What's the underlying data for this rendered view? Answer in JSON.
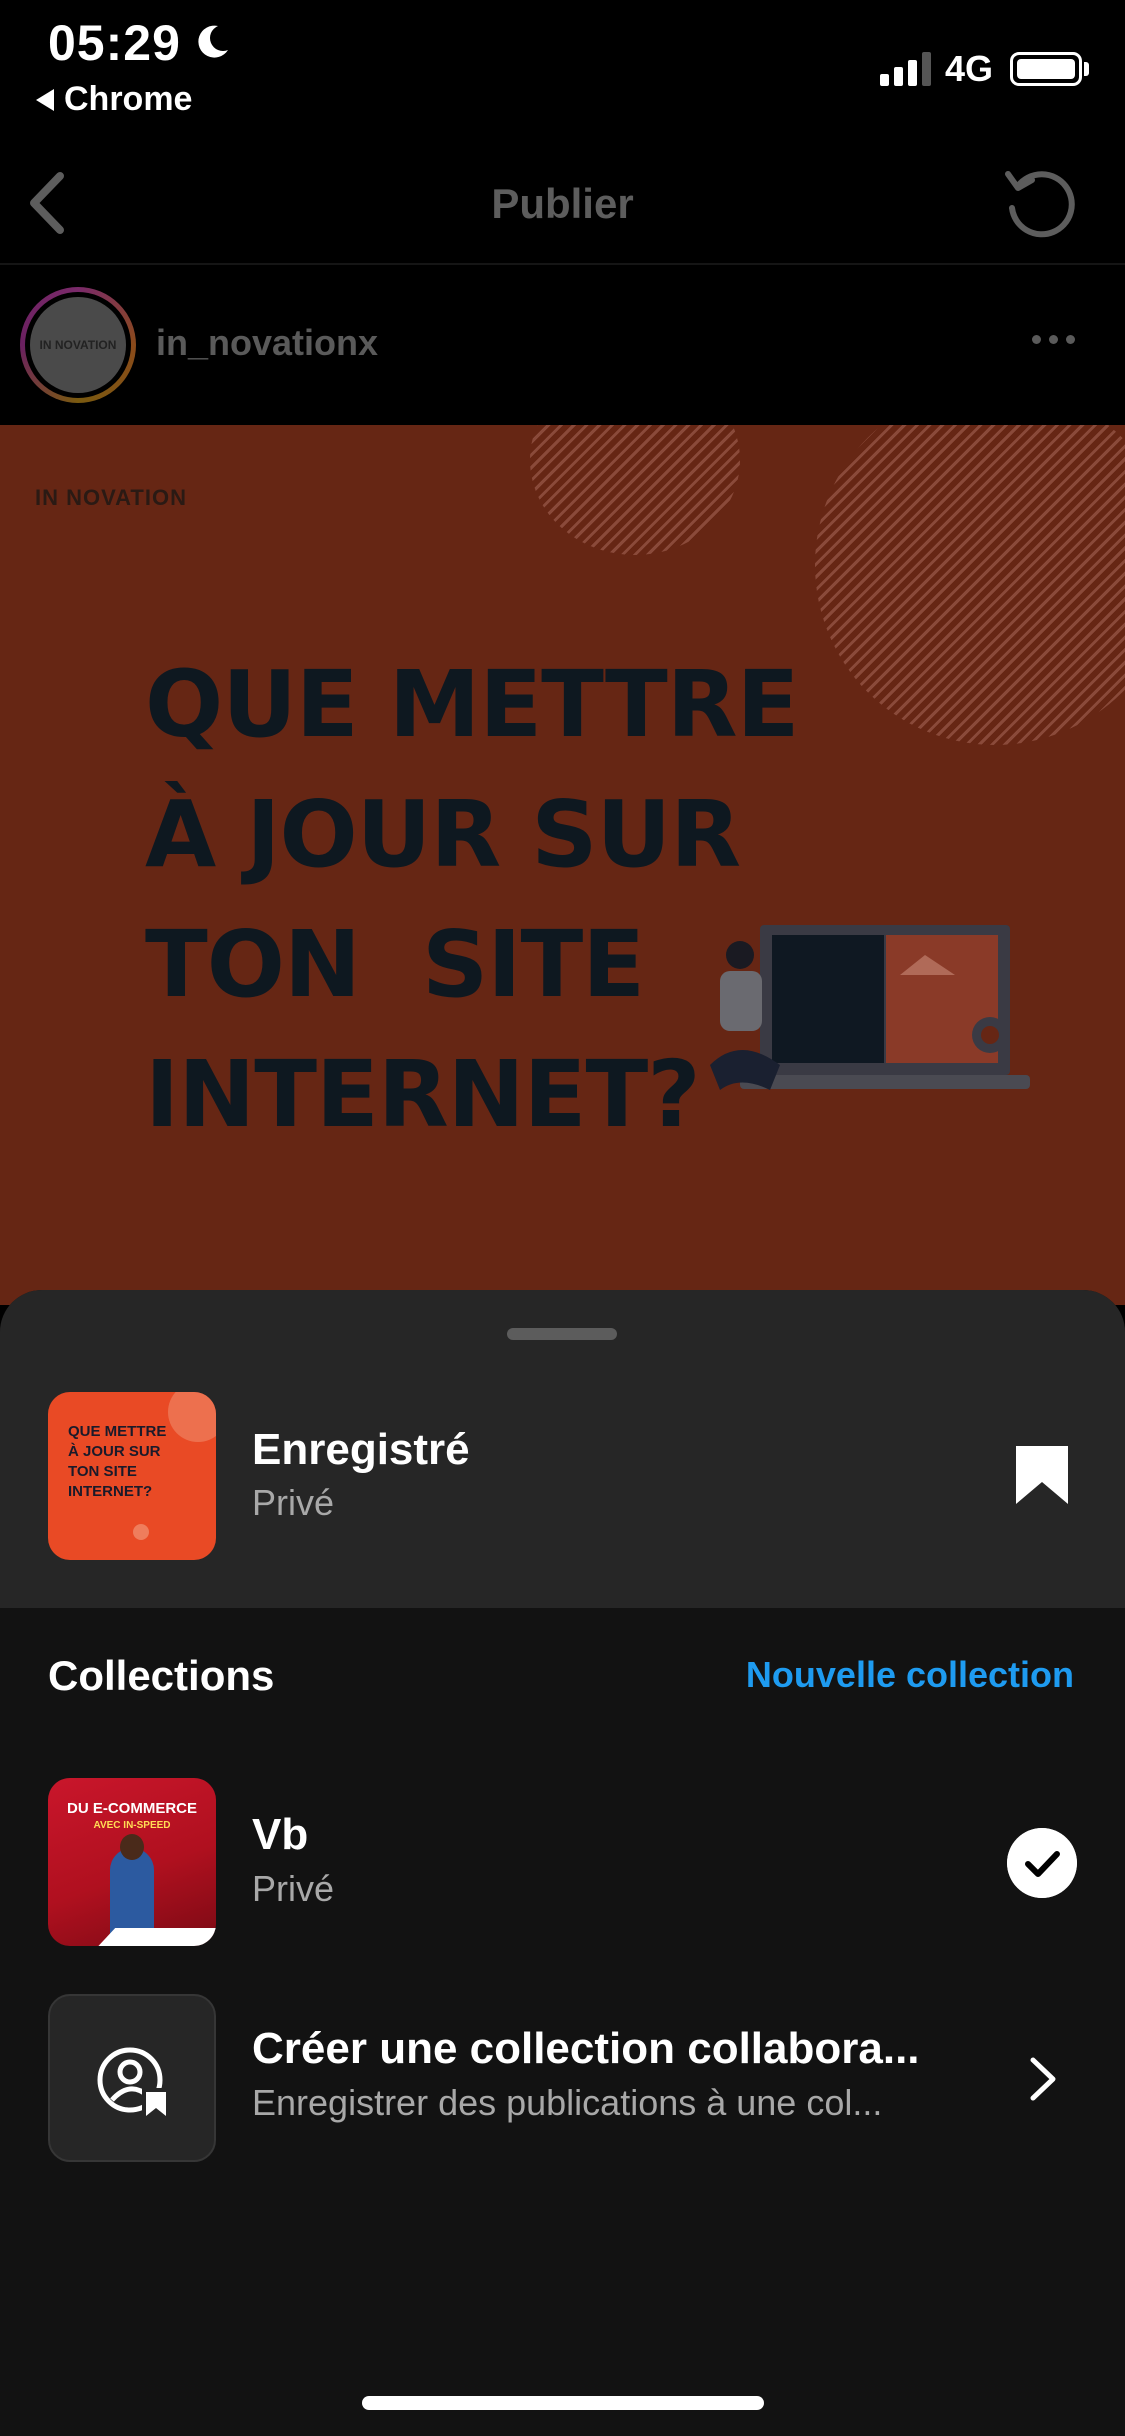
{
  "status_bar": {
    "time": "05:29",
    "back_app": "Chrome",
    "network": "4G"
  },
  "nav": {
    "title": "Publier",
    "back_icon": "chevron-left-icon",
    "refresh_icon": "refresh-icon"
  },
  "author": {
    "username": "in_novationx",
    "avatar_text": "IN NOVATION",
    "more_icon": "more-horizontal-icon"
  },
  "post": {
    "logo": "IN NOVATION",
    "headline": [
      "QUE METTRE",
      "À JOUR SUR",
      "TON  SITE",
      "INTERNET?"
    ]
  },
  "sheet": {
    "saved": {
      "title": "Enregistré",
      "subtitle": "Privé",
      "thumb_text": "QUE METTRE À JOUR SUR TON SITE INTERNET?",
      "icon": "bookmark-filled-icon"
    },
    "collections_heading": "Collections",
    "new_collection": "Nouvelle collection",
    "items": [
      {
        "title": "Vb",
        "subtitle": "Privé",
        "thumb_line1": "DU E-COMMERCE",
        "thumb_line2": "AVEC IN-SPEED",
        "selected": true,
        "icon": "check-circle-icon"
      },
      {
        "title": "Créer une collection collabora...",
        "subtitle": "Enregistrer des publications à une col...",
        "icon": "collaborative-collection-icon",
        "trailing_icon": "chevron-right-icon"
      }
    ]
  },
  "colors": {
    "accent": "#1e9bf0",
    "sheet_bg": "#121212",
    "sheet_header_bg": "#262626",
    "post_bg": "#662614"
  }
}
